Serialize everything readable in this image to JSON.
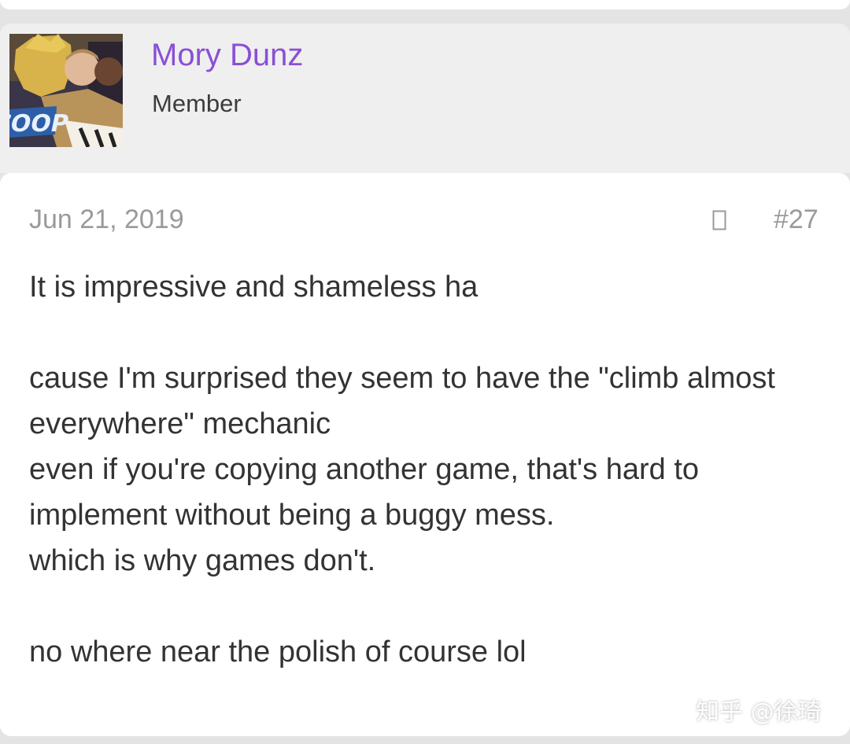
{
  "user": {
    "name": "Mory Dunz",
    "role": "Member",
    "avatar_icon": "cartoon-avatar-image"
  },
  "post": {
    "date": "Jun 21, 2019",
    "share_icon": "share-icon",
    "number": "#27",
    "body": "It is impressive and shameless ha\n\ncause I'm surprised they seem to have the \"climb almost everywhere\" mechanic\neven if you're copying another game, that's hard to implement without being a buggy mess.\nwhich is why games don't.\n\nno where near the polish of course lol"
  },
  "watermark": "知乎 @徐琦",
  "colors": {
    "username": "#8a4fd6",
    "meta_gray": "#9a9a9a",
    "body_text": "#333333",
    "header_bg": "#efefef"
  }
}
